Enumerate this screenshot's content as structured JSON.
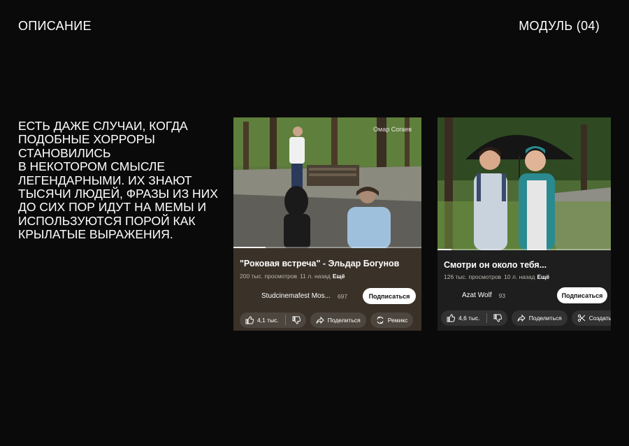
{
  "header": {
    "left": "ОПИСАНИЕ",
    "right": "МОДУЛЬ (04)"
  },
  "description": {
    "lines": [
      "ЕСТЬ ДАЖЕ СЛУЧАИ, КОГДА",
      "ПОДОБНЫЕ ХОРРОРЫ",
      "СТАНОВИЛИСЬ",
      "В НЕКОТОРОМ СМЫСЛЕ",
      "ЛЕГЕНДАРНЫМИ. ИХ ЗНАЮТ",
      "ТЫСЯЧИ ЛЮДЕЙ, ФРАЗЫ ИЗ НИХ",
      "ДО СИХ ПОР ИДУТ НА МЕМЫ И",
      "ИСПОЛЬЗУЮТСЯ ПОРОЙ КАК",
      "КРЫЛАТЫЕ ВЫРАЖЕНИЯ."
    ]
  },
  "videos": [
    {
      "watermark": "Омар Согаев",
      "title": "\"Роковая встреча\" - Эльдар Богунов",
      "views": "200 тыс. просмотров",
      "age": "11 л. назад",
      "more": "Ещё",
      "channel": "Studcinemafest Mos...",
      "subscribers": "697",
      "subscribe_label": "Подписаться",
      "likes": "4,1 тыс.",
      "share_label": "Поделиться",
      "third_action": "Ремикс",
      "progress": 0.17
    },
    {
      "title": "Смотри он около тебя...",
      "views": "126 тыс. просмотров",
      "age": "10 л. назад",
      "more": "Ещё",
      "channel": "Azat Wolf",
      "subscribers": "93",
      "subscribe_label": "Подписаться",
      "likes": "4,6 тыс.",
      "share_label": "Поделиться",
      "third_action": "Создать клип",
      "progress": 0.08
    }
  ],
  "colors": {
    "background": "#0a0a0a",
    "card1": "#3a3229",
    "card2": "#1e1e1e",
    "text": "#ffffff"
  },
  "icons": [
    "thumbs-up-icon",
    "thumbs-down-icon",
    "share-icon",
    "remix-icon",
    "clip-icon"
  ]
}
